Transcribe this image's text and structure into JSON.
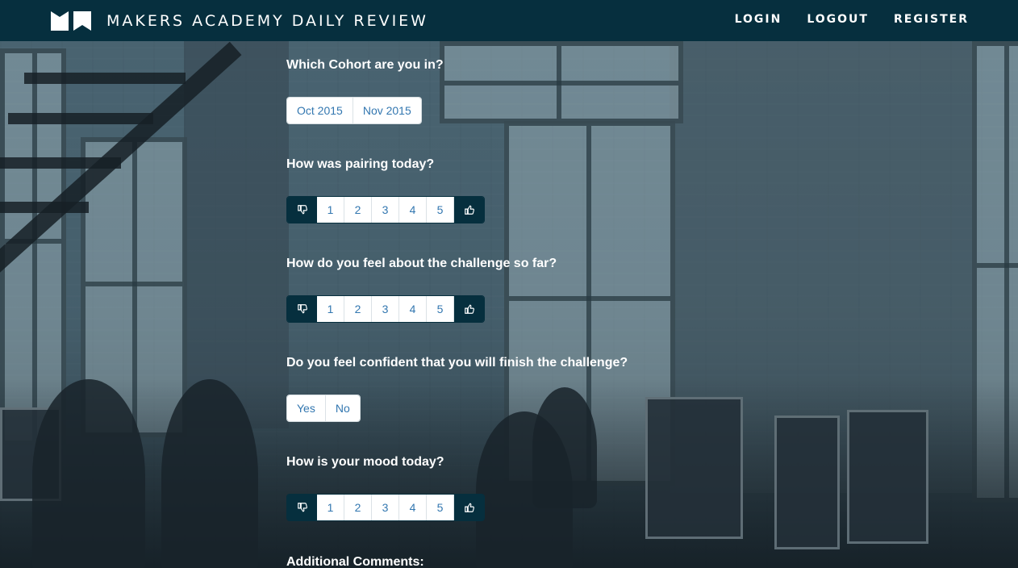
{
  "header": {
    "brand": "MAKERS ACADEMY DAILY REVIEW",
    "nav": [
      "LOGIN",
      "LOGOUT",
      "REGISTER"
    ]
  },
  "form": {
    "cohort": {
      "label": "Which Cohort are you in?",
      "options": [
        "Oct 2015",
        "Nov 2015"
      ]
    },
    "pairing": {
      "label": "How was pairing today?",
      "options": [
        "1",
        "2",
        "3",
        "4",
        "5"
      ]
    },
    "challenge": {
      "label": "How do you feel about the challenge so far?",
      "options": [
        "1",
        "2",
        "3",
        "4",
        "5"
      ]
    },
    "confidence": {
      "label": "Do you feel confident that you will finish the challenge?",
      "options": [
        "Yes",
        "No"
      ]
    },
    "mood": {
      "label": "How is your mood today?",
      "options": [
        "1",
        "2",
        "3",
        "4",
        "5"
      ]
    },
    "comments": {
      "label": "Additional Comments:"
    }
  },
  "colors": {
    "navbar": "#062f3e",
    "button_text": "#3377b0",
    "thumb_bg": "#062f3e"
  },
  "icons": {
    "thumbs_down": "thumbs-down-icon",
    "thumbs_up": "thumbs-up-icon",
    "logo": "makers-logo-icon"
  }
}
